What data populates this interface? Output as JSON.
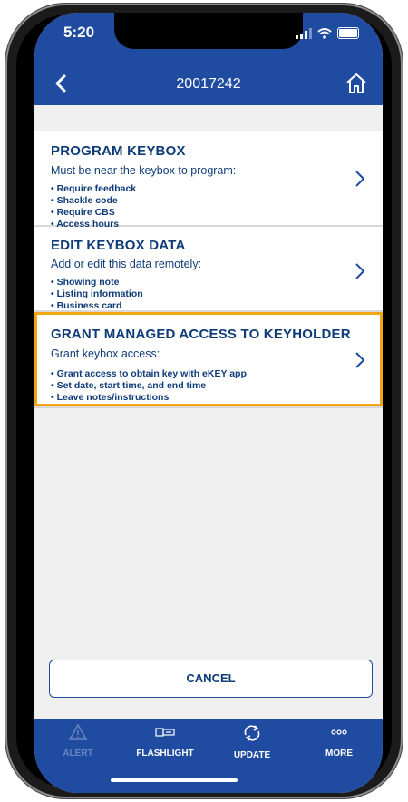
{
  "status": {
    "time": "5:20"
  },
  "navbar": {
    "title": "20017242"
  },
  "cards": [
    {
      "title": "PROGRAM KEYBOX",
      "subtitle": "Must be near the keybox to program:",
      "bullets": [
        "Require feedback",
        "Shackle code",
        "Require CBS",
        "Access hours"
      ]
    },
    {
      "title": "EDIT KEYBOX DATA",
      "subtitle": "Add or edit this data remotely:",
      "bullets": [
        "Showing note",
        "Listing information",
        "Business card"
      ]
    },
    {
      "title": "GRANT MANAGED ACCESS TO KEYHOLDER",
      "subtitle": "Grant keybox access:",
      "bullets": [
        "Grant access to obtain key with eKEY app",
        "Set date, start time, and end time",
        "Leave notes/instructions"
      ]
    }
  ],
  "cancel": {
    "label": "CANCEL"
  },
  "tabs": [
    {
      "label": "ALERT",
      "icon": "warning-icon"
    },
    {
      "label": "FLASHLIGHT",
      "icon": "flashlight-icon"
    },
    {
      "label": "UPDATE",
      "icon": "sync-icon"
    },
    {
      "label": "MORE",
      "icon": "more-icon"
    }
  ],
  "colors": {
    "brand": "#1f4ba0",
    "text": "#0f3c78",
    "highlight": "#f2a712"
  }
}
